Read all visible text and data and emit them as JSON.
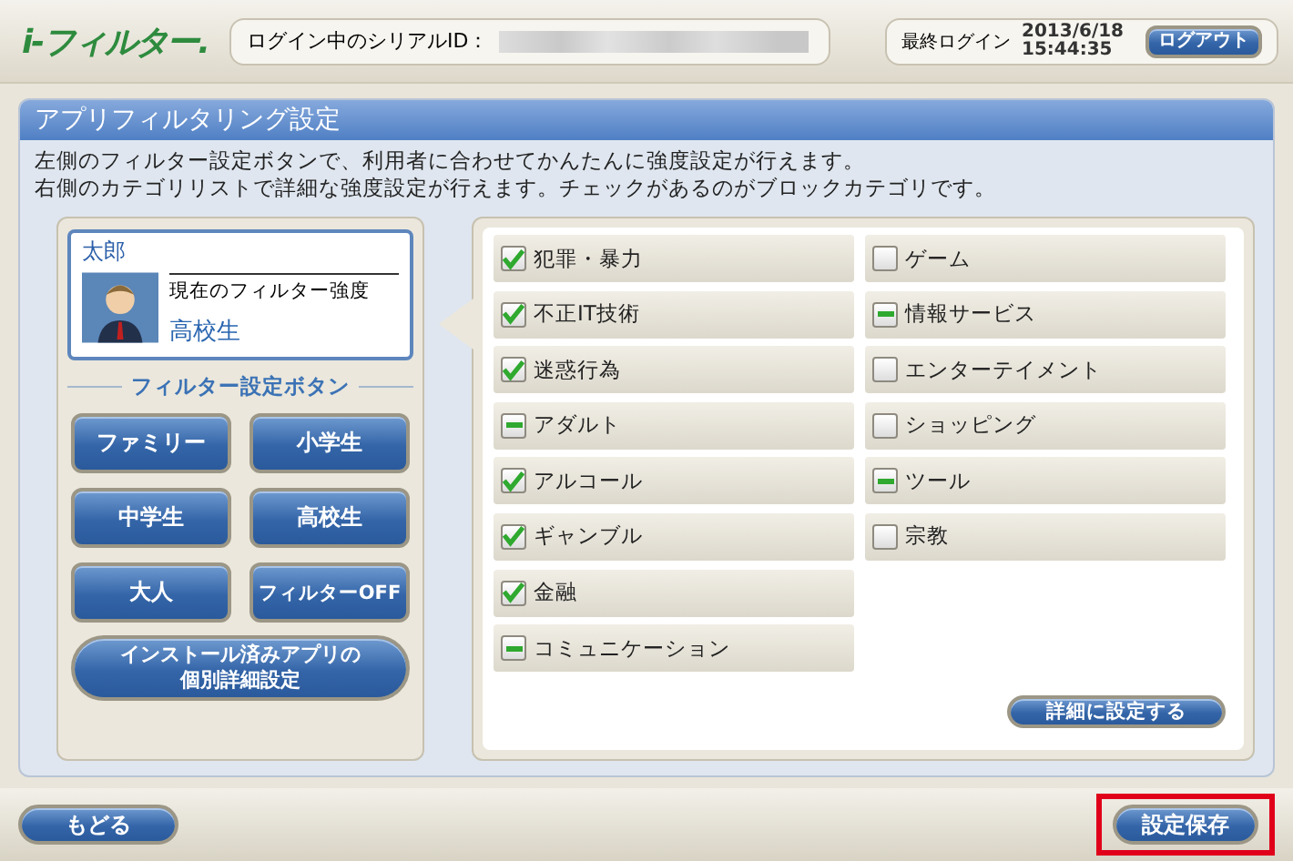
{
  "header": {
    "logo": "i-フィルター.",
    "serial_label": "ログイン中のシリアルID：",
    "last_login_label": "最終ログイン",
    "last_login_date": "2013/6/18",
    "last_login_time": "15:44:35",
    "logout_button": "ログアウト"
  },
  "panel": {
    "title": "アプリフィルタリング設定",
    "description": [
      "左側のフィルター設定ボタンで、利用者に合わせてかんたんに強度設定が行えます。",
      "右側のカテゴリリストで詳細な強度設定が行えます。チェックがあるのがブロックカテゴリです。"
    ]
  },
  "user": {
    "name": "太郎",
    "strength_label": "現在のフィルター強度",
    "strength": "高校生"
  },
  "filter_buttons_heading": "フィルター設定ボタン",
  "filter_buttons": [
    "ファミリー",
    "小学生",
    "中学生",
    "高校生",
    "大人",
    "フィルターOFF"
  ],
  "app_settings_button": [
    "インストール済みアプリの",
    "個別詳細設定"
  ],
  "categories": [
    {
      "label": "犯罪・暴力",
      "checked": true
    },
    {
      "label": "不正IT技術",
      "checked": true
    },
    {
      "label": "迷惑行為",
      "checked": true
    },
    {
      "label": "アダルト",
      "checked": false,
      "partial": true
    },
    {
      "label": "アルコール",
      "checked": true
    },
    {
      "label": "ギャンブル",
      "checked": true
    },
    {
      "label": "金融",
      "checked": true
    },
    {
      "label": "コミュニケーション",
      "checked": false,
      "partial": true
    },
    {
      "label": "ゲーム",
      "checked": false,
      "partial": false
    },
    {
      "label": "情報サービス",
      "checked": false,
      "partial": true
    },
    {
      "label": "エンターテイメント",
      "checked": false,
      "partial": false
    },
    {
      "label": "ショッピング",
      "checked": false,
      "partial": false
    },
    {
      "label": "ツール",
      "checked": false,
      "partial": true
    },
    {
      "label": "宗教",
      "checked": false,
      "partial": false
    }
  ],
  "detail_button": "詳細に設定する",
  "footer": {
    "back_button": "もどる",
    "save_button": {
      "label": "設定保存",
      "highlighted": true
    }
  }
}
